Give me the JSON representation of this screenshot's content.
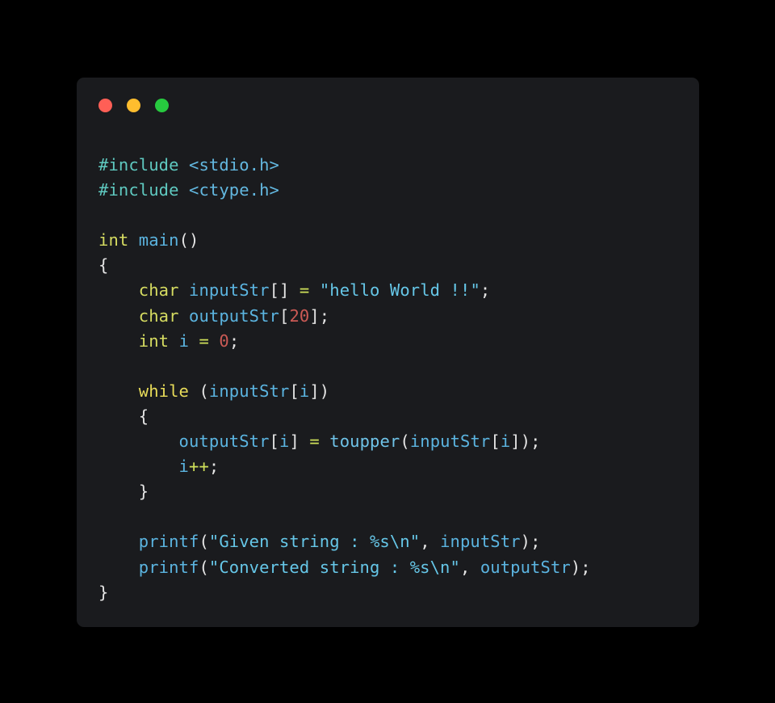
{
  "window": {
    "background_color": "#000000",
    "card_background_color": "#1a1b1e",
    "controls": [
      {
        "name": "close",
        "label": "close-button",
        "color": "#ff5f56"
      },
      {
        "name": "minimize",
        "label": "minimize-button",
        "color": "#ffbd2e"
      },
      {
        "name": "maximize",
        "label": "maximize-button",
        "color": "#27c93f"
      }
    ]
  },
  "code": {
    "language": "c",
    "palette": {
      "preprocessor": "#5fc9c0",
      "header": "#63b8e0",
      "type": "#d6dc61",
      "keyword": "#e8dc59",
      "identifier": "#5bb4e0",
      "function": "#6fc3e8",
      "string": "#66c7e8",
      "number": "#cb5a55",
      "operator": "#cfe05a",
      "punctuation": "#e4e4e4"
    },
    "lines": [
      [
        {
          "t": "#include",
          "c": "pre"
        },
        {
          "t": " ",
          "c": "punct"
        },
        {
          "t": "<stdio.h>",
          "c": "header"
        }
      ],
      [
        {
          "t": "#include",
          "c": "pre"
        },
        {
          "t": " ",
          "c": "punct"
        },
        {
          "t": "<ctype.h>",
          "c": "header"
        }
      ],
      [],
      [
        {
          "t": "int",
          "c": "type"
        },
        {
          "t": " ",
          "c": "punct"
        },
        {
          "t": "main",
          "c": "ident"
        },
        {
          "t": "()",
          "c": "punct"
        }
      ],
      [
        {
          "t": "{",
          "c": "punct"
        }
      ],
      [
        {
          "t": "    ",
          "c": "punct"
        },
        {
          "t": "char",
          "c": "type"
        },
        {
          "t": " ",
          "c": "punct"
        },
        {
          "t": "inputStr",
          "c": "ident"
        },
        {
          "t": "[]",
          "c": "punct"
        },
        {
          "t": " ",
          "c": "punct"
        },
        {
          "t": "=",
          "c": "op"
        },
        {
          "t": " ",
          "c": "punct"
        },
        {
          "t": "\"hello World !!\"",
          "c": "str"
        },
        {
          "t": ";",
          "c": "punct"
        }
      ],
      [
        {
          "t": "    ",
          "c": "punct"
        },
        {
          "t": "char",
          "c": "type"
        },
        {
          "t": " ",
          "c": "punct"
        },
        {
          "t": "outputStr",
          "c": "ident"
        },
        {
          "t": "[",
          "c": "punct"
        },
        {
          "t": "20",
          "c": "num"
        },
        {
          "t": "];",
          "c": "punct"
        }
      ],
      [
        {
          "t": "    ",
          "c": "punct"
        },
        {
          "t": "int",
          "c": "type"
        },
        {
          "t": " ",
          "c": "punct"
        },
        {
          "t": "i",
          "c": "ident"
        },
        {
          "t": " ",
          "c": "punct"
        },
        {
          "t": "=",
          "c": "op"
        },
        {
          "t": " ",
          "c": "punct"
        },
        {
          "t": "0",
          "c": "num"
        },
        {
          "t": ";",
          "c": "punct"
        }
      ],
      [],
      [
        {
          "t": "    ",
          "c": "punct"
        },
        {
          "t": "while",
          "c": "kw"
        },
        {
          "t": " (",
          "c": "punct"
        },
        {
          "t": "inputStr",
          "c": "ident"
        },
        {
          "t": "[",
          "c": "punct"
        },
        {
          "t": "i",
          "c": "ident"
        },
        {
          "t": "])",
          "c": "punct"
        }
      ],
      [
        {
          "t": "    ",
          "c": "punct"
        },
        {
          "t": "{",
          "c": "punct"
        }
      ],
      [
        {
          "t": "        ",
          "c": "punct"
        },
        {
          "t": "outputStr",
          "c": "ident"
        },
        {
          "t": "[",
          "c": "punct"
        },
        {
          "t": "i",
          "c": "ident"
        },
        {
          "t": "]",
          "c": "punct"
        },
        {
          "t": " ",
          "c": "punct"
        },
        {
          "t": "=",
          "c": "op"
        },
        {
          "t": " ",
          "c": "punct"
        },
        {
          "t": "toupper",
          "c": "fn"
        },
        {
          "t": "(",
          "c": "punct"
        },
        {
          "t": "inputStr",
          "c": "ident"
        },
        {
          "t": "[",
          "c": "punct"
        },
        {
          "t": "i",
          "c": "ident"
        },
        {
          "t": "]);",
          "c": "punct"
        }
      ],
      [
        {
          "t": "        ",
          "c": "punct"
        },
        {
          "t": "i",
          "c": "ident"
        },
        {
          "t": "++",
          "c": "op"
        },
        {
          "t": ";",
          "c": "punct"
        }
      ],
      [
        {
          "t": "    ",
          "c": "punct"
        },
        {
          "t": "}",
          "c": "punct"
        }
      ],
      [],
      [
        {
          "t": "    ",
          "c": "punct"
        },
        {
          "t": "printf",
          "c": "ident"
        },
        {
          "t": "(",
          "c": "punct"
        },
        {
          "t": "\"Given string : %s\\n\"",
          "c": "str"
        },
        {
          "t": ", ",
          "c": "punct"
        },
        {
          "t": "inputStr",
          "c": "ident"
        },
        {
          "t": ");",
          "c": "punct"
        }
      ],
      [
        {
          "t": "    ",
          "c": "punct"
        },
        {
          "t": "printf",
          "c": "ident"
        },
        {
          "t": "(",
          "c": "punct"
        },
        {
          "t": "\"Converted string : %s\\n\"",
          "c": "str"
        },
        {
          "t": ", ",
          "c": "punct"
        },
        {
          "t": "outputStr",
          "c": "ident"
        },
        {
          "t": ");",
          "c": "punct"
        }
      ],
      [
        {
          "t": "}",
          "c": "punct"
        }
      ]
    ],
    "plain_text": "#include <stdio.h>\n#include <ctype.h>\n\nint main()\n{\n    char inputStr[] = \"hello World !!\";\n    char outputStr[20];\n    int i = 0;\n\n    while (inputStr[i])\n    {\n        outputStr[i] = toupper(inputStr[i]);\n        i++;\n    }\n\n    printf(\"Given string : %s\\n\", inputStr);\n    printf(\"Converted string : %s\\n\", outputStr);\n}"
  }
}
